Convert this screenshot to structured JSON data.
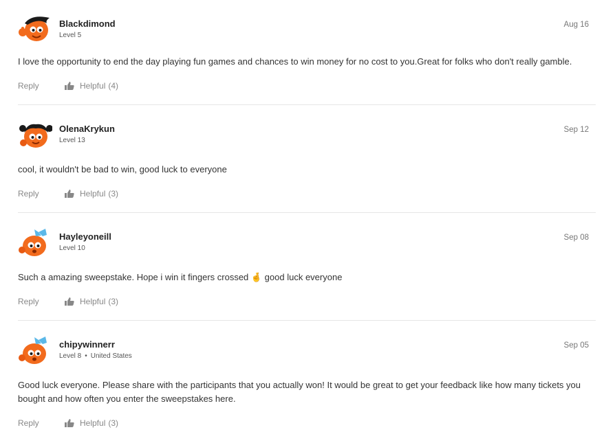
{
  "comments": [
    {
      "username": "Blackdimond",
      "level": "Level 5",
      "location": "",
      "date": "Aug 16",
      "text": "I love the opportunity to end the day playing fun games and chances to win money for no cost to you.Great for folks who don't really gamble.",
      "reply_label": "Reply",
      "helpful_label": "Helpful",
      "helpful_count": "(4)",
      "avatar": "orange-boy-thumbs-up-avatar"
    },
    {
      "username": "OlenaKrykun",
      "level": "Level 13",
      "location": "",
      "date": "Sep 12",
      "text": "cool, it wouldn't be bad to win, good luck to everyone",
      "reply_label": "Reply",
      "helpful_label": "Helpful",
      "helpful_count": "(3)",
      "avatar": "orange-girl-pigtails-avatar"
    },
    {
      "username": "Hayleyoneill",
      "level": "Level 10",
      "location": "",
      "date": "Sep 08",
      "text": "Such a amazing sweepstake. Hope i win it fingers crossed 🤞 good luck everyone",
      "reply_label": "Reply",
      "helpful_label": "Helpful",
      "helpful_count": "(3)",
      "avatar": "orange-bow-avatar"
    },
    {
      "username": "chipywinnerr",
      "level": "Level 8",
      "location": "United States",
      "date": "Sep 05",
      "text": "Good luck everyone. Please share with the participants that you actually won! It would be great to get your feedback like how many tickets you bought and how often you enter the sweepstakes here.",
      "reply_label": "Reply",
      "helpful_label": "Helpful",
      "helpful_count": "(3)",
      "avatar": "orange-bow-avatar"
    }
  ],
  "colors": {
    "avatar_orange": "#f26b1d",
    "username": "#222222",
    "muted": "#888888",
    "divider": "#e6e6e6"
  },
  "icons": {
    "helpful": "thumbs-up-icon"
  }
}
